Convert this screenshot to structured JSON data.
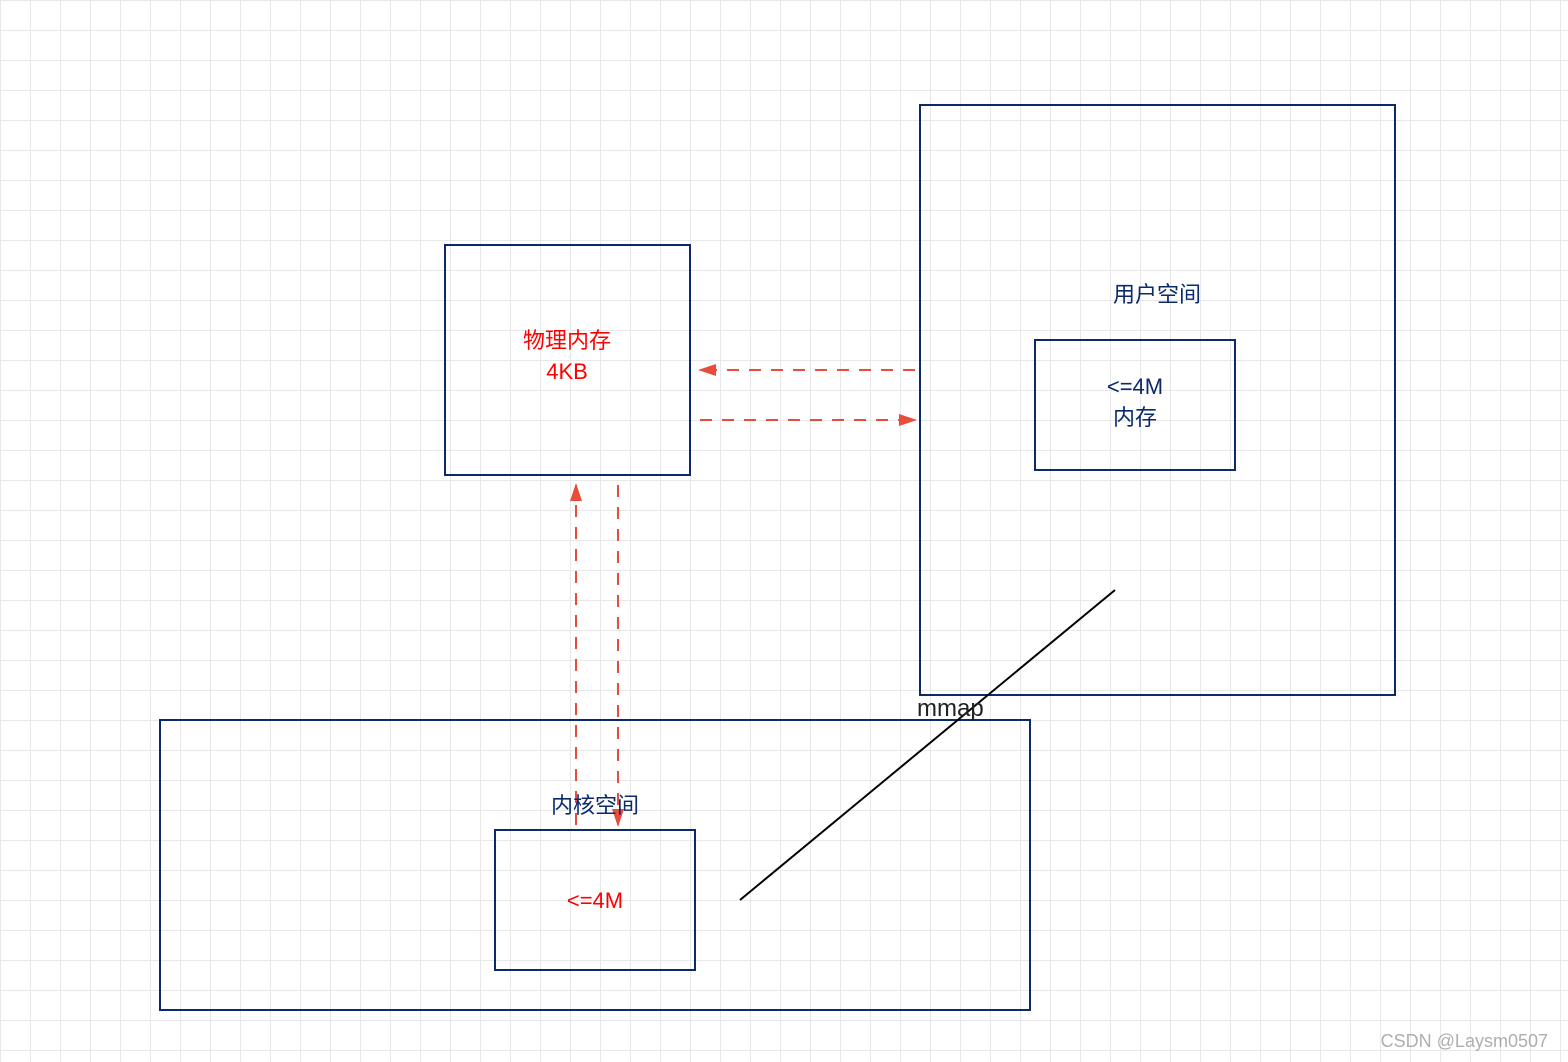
{
  "boxes": {
    "physical": {
      "line1": "物理内存",
      "line2": "4KB"
    },
    "userspace": {
      "title": "用户空间",
      "inner_line1": "<=4M",
      "inner_line2": "内存"
    },
    "kernelspace": {
      "title": "内核空间",
      "inner": "<=4M"
    }
  },
  "labels": {
    "mmap": "mmap",
    "watermark": "CSDN @Laysm0507"
  }
}
